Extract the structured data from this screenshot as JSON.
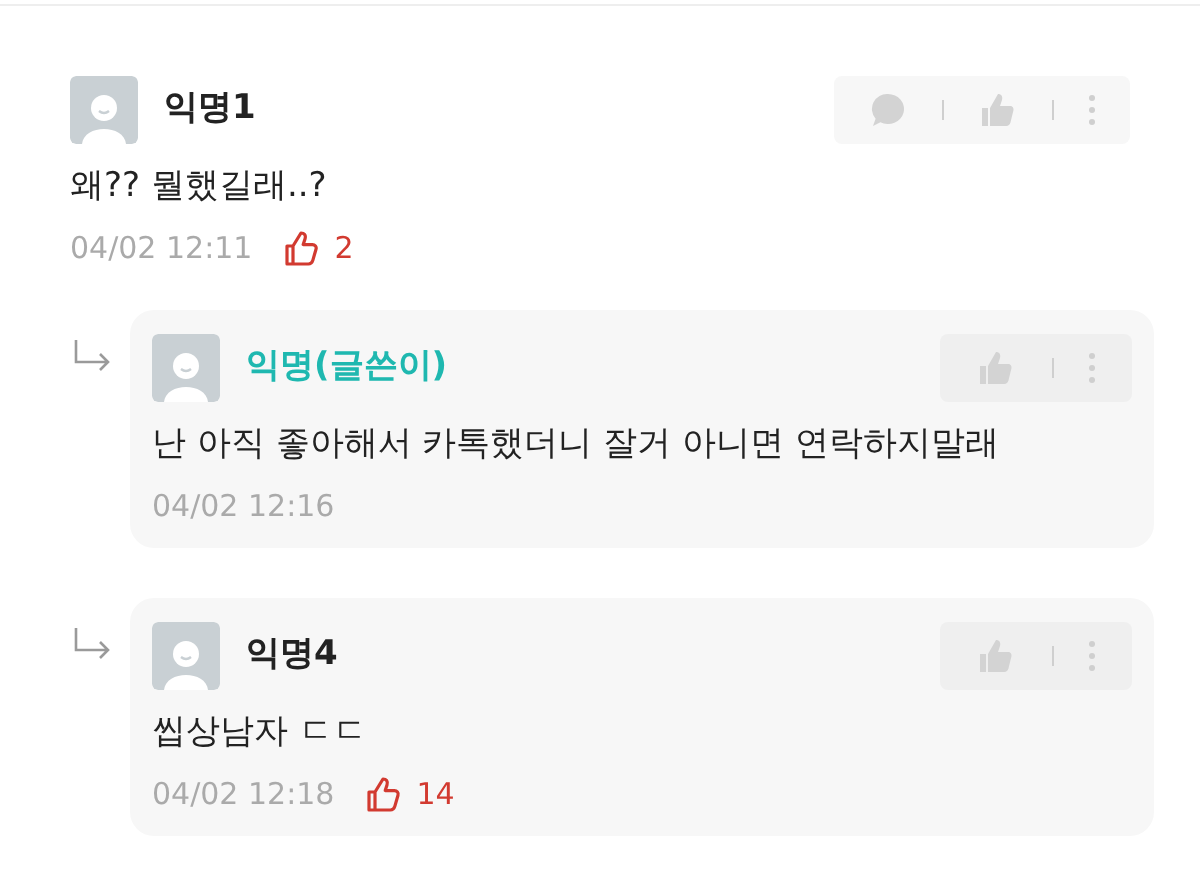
{
  "comment": {
    "author": "익명1",
    "is_writer": false,
    "text": "왜?? 뭘했길래..?",
    "time": "04/02 12:11",
    "likes": "2",
    "replies": [
      {
        "author": "익명(글쓴이)",
        "is_writer": true,
        "text": "난 아직 좋아해서 카톡했더니 잘거 아니면 연락하지말래",
        "time": "04/02 12:16"
      },
      {
        "author": "익명4",
        "is_writer": false,
        "text": "씹상남자 ㄷㄷ",
        "time": "04/02 12:18",
        "likes": "14"
      }
    ]
  }
}
